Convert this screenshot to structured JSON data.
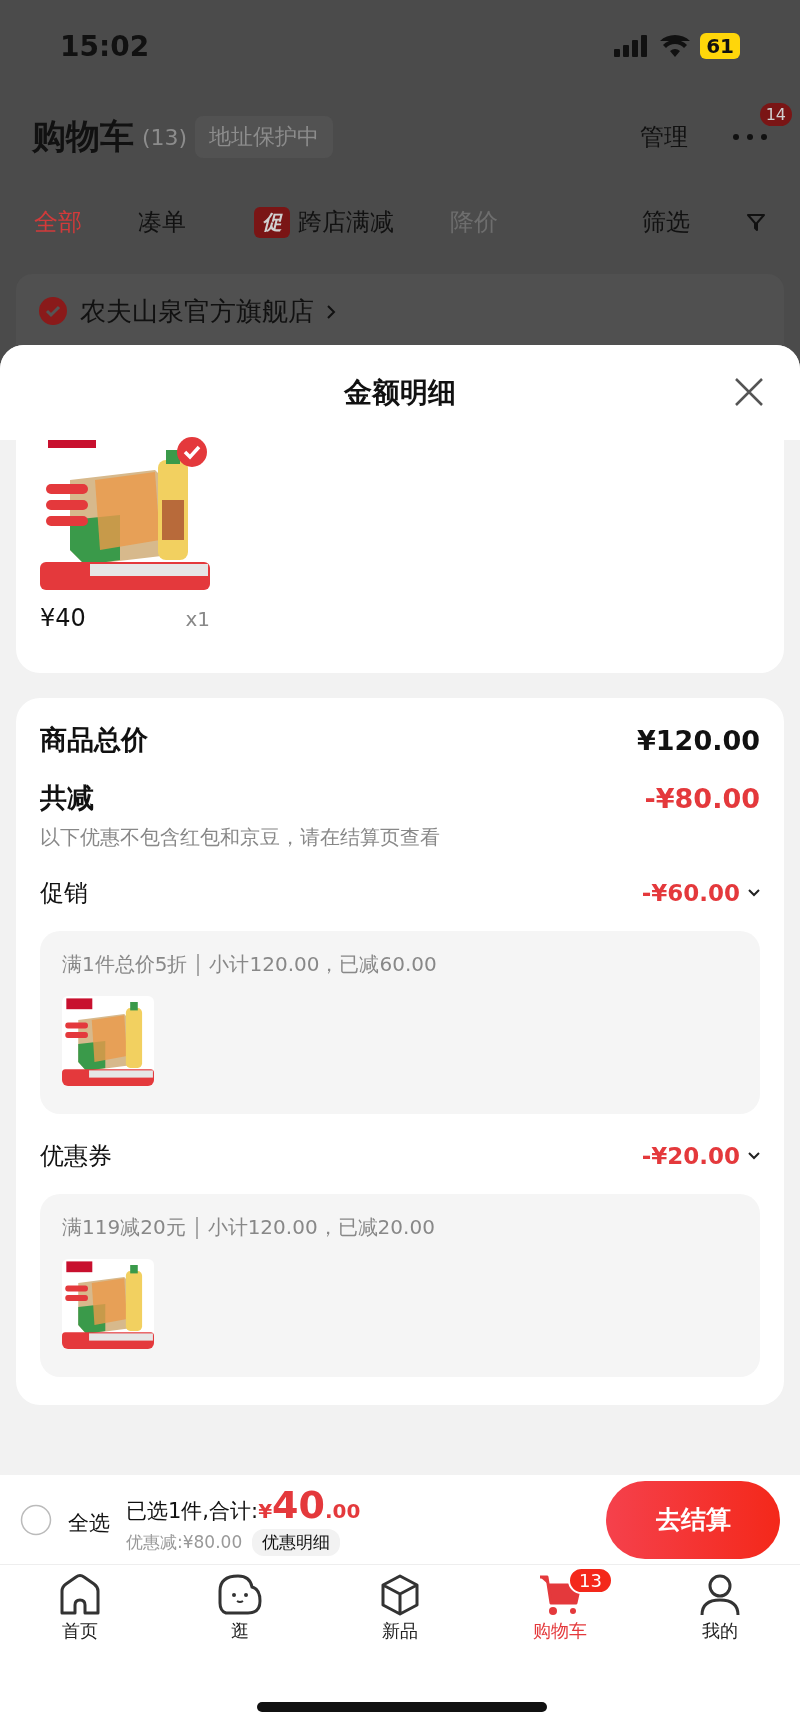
{
  "status_bar": {
    "time": "15:02",
    "battery": "61"
  },
  "header": {
    "title": "购物车",
    "count": "(13)",
    "address": "地址保护中",
    "manage": "管理",
    "more_badge": "14"
  },
  "tabs": [
    {
      "label": "全部",
      "selected": true,
      "disabled": false
    },
    {
      "label": "凑单",
      "selected": false,
      "disabled": false
    },
    {
      "label": "跨店满减",
      "tag": "促",
      "selected": false,
      "disabled": false
    },
    {
      "label": "降价",
      "selected": false,
      "disabled": true
    }
  ],
  "filter": "筛选",
  "store": {
    "name": "农夫山泉官方旗舰店",
    "checked": true
  },
  "sheet": {
    "title": "金额明细",
    "item": {
      "kind": "picture",
      "checked": true,
      "price": "¥40",
      "quantity": "x1"
    },
    "total": {
      "label": "商品总价",
      "value": "¥120.00"
    },
    "reduction": {
      "label": "共减",
      "value": "-¥80.00",
      "note": "以下优惠不包含红包和京豆，请在结算页查看"
    },
    "sections": [
      {
        "label": "促销",
        "amount": "-¥60.00",
        "expanded": true,
        "rule": "满1件总价5折",
        "subtotal": "小计120.00，已减60.00"
      },
      {
        "label": "优惠券",
        "amount": "-¥20.00",
        "expanded": true,
        "rule": "满119减20元",
        "subtotal": "小计120.00，已减20.00"
      }
    ]
  },
  "footer": {
    "select_all": {
      "label": "全选",
      "checked": false
    },
    "summary": "已选1件,合计:",
    "currency": "¥",
    "amount": "40",
    "decimals": ".00",
    "discount": "优惠减:¥80.00",
    "detail_button": "优惠明细",
    "checkout": "去结算"
  },
  "tab_bar": [
    {
      "label": "首页",
      "kind": "home",
      "selected": false
    },
    {
      "label": "逛",
      "kind": "face",
      "selected": false
    },
    {
      "label": "新品",
      "kind": "cube",
      "selected": false
    },
    {
      "label": "购物车",
      "kind": "cart",
      "selected": true,
      "badge": "13"
    },
    {
      "label": "我的",
      "kind": "person",
      "selected": false
    }
  ]
}
